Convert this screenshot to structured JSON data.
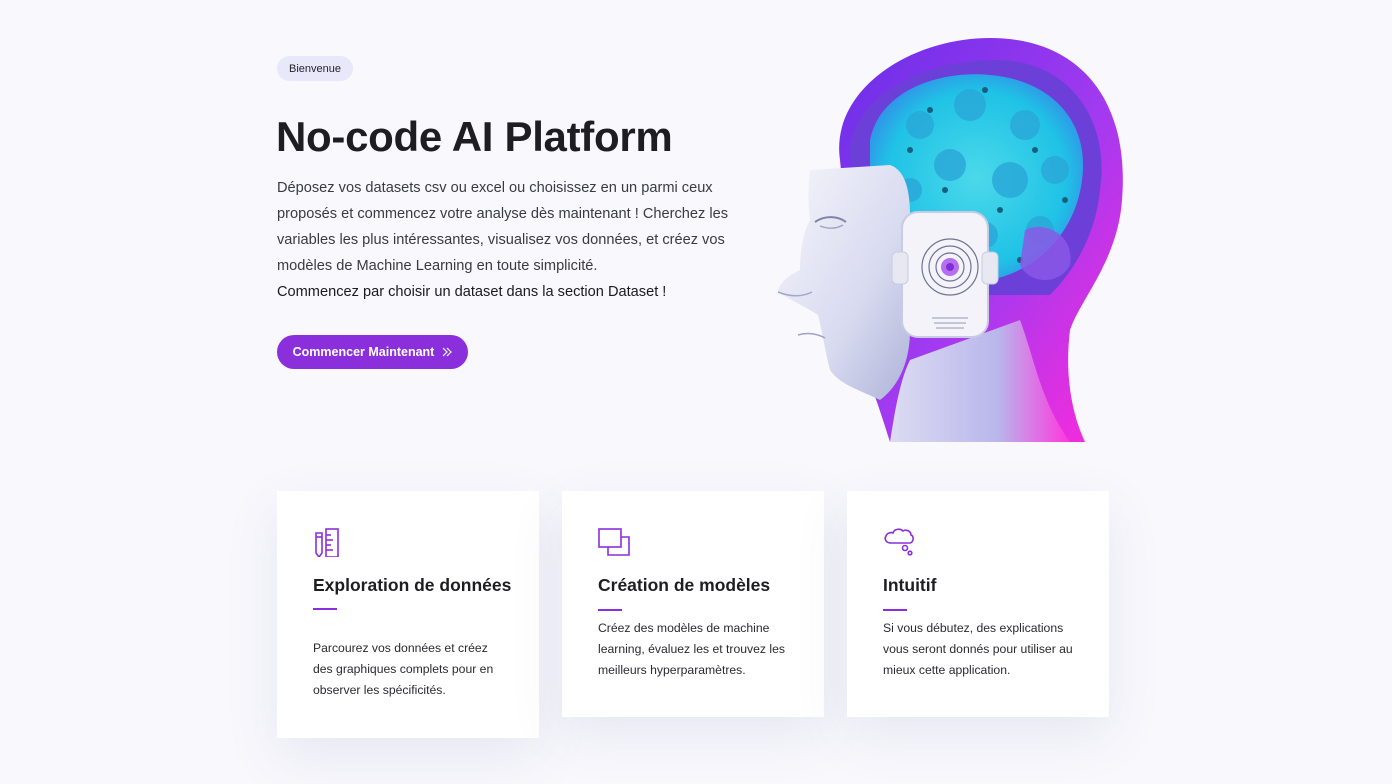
{
  "hero": {
    "badge": "Bienvenue",
    "title": "No-code AI Platform",
    "description": "Déposez vos datasets csv ou excel ou choisissez en un parmi ceux proposés et commencez votre analyse dès maintenant ! Cherchez les variables les plus intéressantes, visualisez vos données, et créez vos modèles de Machine Learning en toute simplicité.",
    "cta_text": "Commencez par choisir un dataset dans la section Dataset !",
    "button_label": "Commencer Maintenant",
    "button_icon": "double-chevron-right-icon",
    "image": "ai-head-illustration"
  },
  "features": [
    {
      "icon": "pencil-ruler-icon",
      "title": "Exploration de données",
      "description": "Parcourez vos données et créez des graphiques complets pour en observer les spécificités."
    },
    {
      "icon": "layers-icon",
      "title": "Création de modèles",
      "description": "Créez des modèles de machine learning, évaluez les et trouvez les meilleurs hyperparamètres."
    },
    {
      "icon": "thought-cloud-icon",
      "title": "Intuitif",
      "description": "Si vous débutez, des explications vous seront donnés pour utiliser au mieux cette application."
    }
  ],
  "colors": {
    "accent": "#8b2fdc",
    "background": "#f8f8fd",
    "badge_bg": "#e9e8fb"
  }
}
